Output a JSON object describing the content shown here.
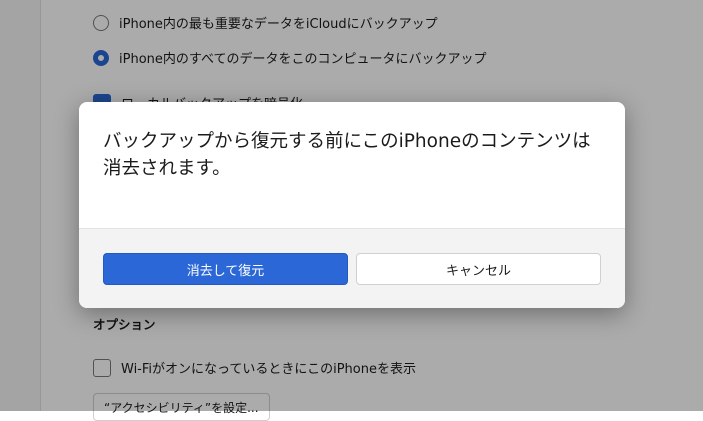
{
  "background": {
    "backup_options": [
      {
        "label": "iPhone内の最も重要なデータをiCloudにバックアップ",
        "selected": false
      },
      {
        "label": "iPhone内のすべてのデータをこのコンピュータにバックアップ",
        "selected": true
      }
    ],
    "encrypt_option": {
      "label": "ローカルバックアップを暗号化",
      "checked": true
    },
    "options_section": {
      "title": "オプション",
      "wifi_option": {
        "label": "Wi-FiがオンになっているときにこのiPhoneを表示",
        "checked": false
      },
      "accessibility_button": "“アクセシビリティ”を設定..."
    }
  },
  "dialog": {
    "message": "バックアップから復元する前にこのiPhoneのコンテンツは消去されます。",
    "primary_button": "消去して復元",
    "secondary_button": "キャンセル"
  },
  "colors": {
    "accent": "#2b67d6",
    "overlay": "rgba(0,0,0,0.33)"
  }
}
